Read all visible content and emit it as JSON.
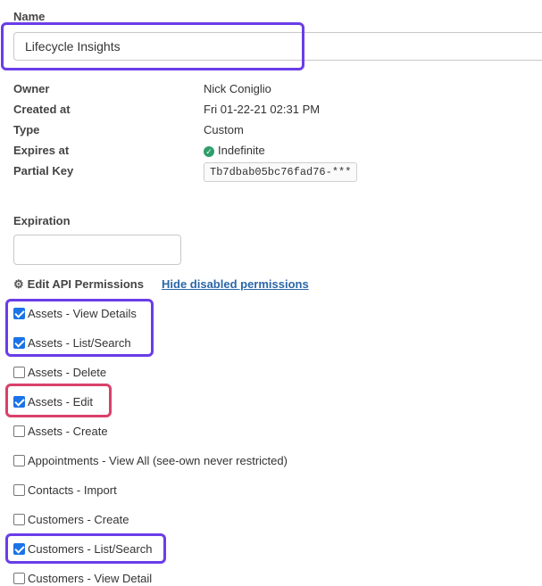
{
  "form": {
    "name_label": "Name",
    "name_value": "Lifecycle Insights",
    "details": {
      "owner_label": "Owner",
      "owner_value": "Nick Coniglio",
      "created_label": "Created at",
      "created_value": "Fri 01-22-21 02:31 PM",
      "type_label": "Type",
      "type_value": "Custom",
      "expires_label": "Expires at",
      "expires_value": "Indefinite",
      "partial_key_label": "Partial Key",
      "partial_key_value": "Tb7dbab05bc76fad76-***"
    },
    "expiration_label": "Expiration",
    "expiration_value": "",
    "permissions_heading": "Edit API Permissions",
    "hide_disabled_link": "Hide disabled permissions",
    "permissions": [
      {
        "label": "Assets - View Details",
        "checked": true
      },
      {
        "label": "Assets - List/Search",
        "checked": true
      },
      {
        "label": "Assets - Delete",
        "checked": false
      },
      {
        "label": "Assets - Edit",
        "checked": true
      },
      {
        "label": "Assets - Create",
        "checked": false
      },
      {
        "label": "Appointments - View All (see-own never restricted)",
        "checked": false
      },
      {
        "label": "Contacts - Import",
        "checked": false
      },
      {
        "label": "Customers - Create",
        "checked": false
      },
      {
        "label": "Customers - List/Search",
        "checked": true
      },
      {
        "label": "Customers - View Detail",
        "checked": false
      }
    ]
  },
  "colors": {
    "highlight_purple": "#6a3de8",
    "highlight_red": "#d9406a",
    "link": "#2a66a8",
    "check_green": "#2e9e6a",
    "checkbox_blue": "#1a73e8"
  }
}
